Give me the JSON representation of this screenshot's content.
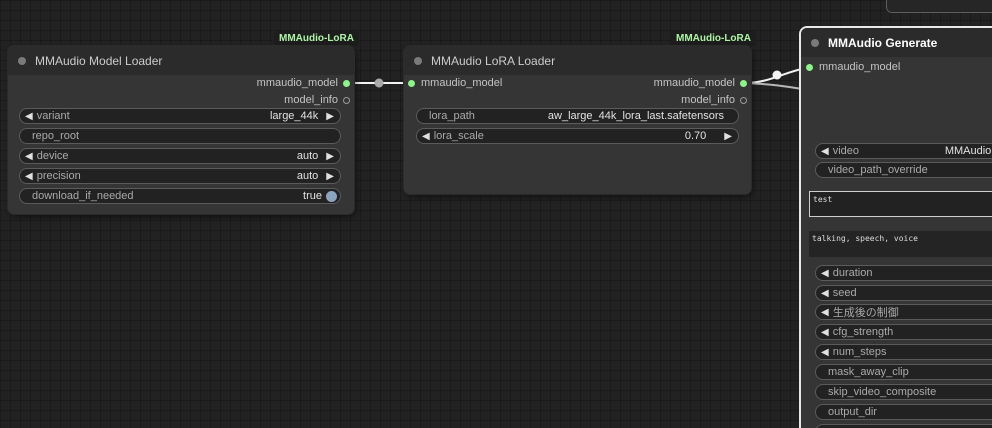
{
  "nodes": {
    "model_loader": {
      "badge": "MMAudio-LoRA",
      "title": "MMAudio Model Loader",
      "outputs": [
        "mmaudio_model",
        "model_info"
      ],
      "widgets": {
        "variant": {
          "label": "variant",
          "value": "large_44k"
        },
        "repo_root": {
          "label": "repo_root"
        },
        "device": {
          "label": "device",
          "value": "auto"
        },
        "precision": {
          "label": "precision",
          "value": "auto"
        },
        "download_if_needed": {
          "label": "download_if_needed",
          "value": "true"
        }
      }
    },
    "lora_loader": {
      "badge": "MMAudio-LoRA",
      "title": "MMAudio LoRA Loader",
      "input": "mmaudio_model",
      "outputs": [
        "mmaudio_model",
        "model_info"
      ],
      "widgets": {
        "lora_path": {
          "label": "lora_path",
          "value": "aw_large_44k_lora_last.safetensors"
        },
        "lora_scale": {
          "label": "lora_scale",
          "value": "0.70"
        }
      }
    },
    "generate": {
      "title": "MMAudio Generate",
      "input": "mmaudio_model",
      "widgets": {
        "video": {
          "label": "video",
          "value": "MMAudioF"
        },
        "video_path_override": {
          "label": "video_path_override"
        },
        "prompt": {
          "value": "test"
        },
        "negative_prompt": {
          "value": "talking, speech, voice"
        },
        "duration": {
          "label": "duration"
        },
        "seed": {
          "label": "seed"
        },
        "after_generate": {
          "label": "生成後の制御"
        },
        "cfg_strength": {
          "label": "cfg_strength"
        },
        "num_steps": {
          "label": "num_steps"
        },
        "mask_away_clip": {
          "label": "mask_away_clip"
        },
        "skip_video_composite": {
          "label": "skip_video_composite"
        },
        "output_dir": {
          "label": "output_dir"
        }
      }
    }
  },
  "colors": {
    "canvas": "#222222",
    "node_body": "#353535",
    "node_title": "#2b2b2b",
    "slot_active": "#8ef38a",
    "badge_text": "#aef4a6",
    "toggle": "#8da4bf"
  },
  "icons": {
    "decrement": "left-triangle",
    "increment": "right-triangle"
  }
}
